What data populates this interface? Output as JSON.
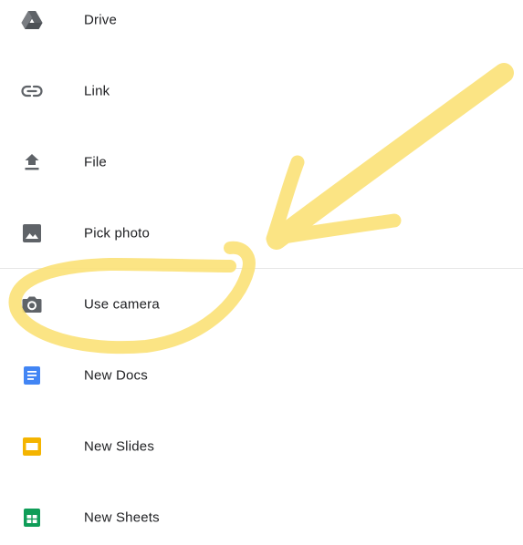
{
  "menu": {
    "items": [
      {
        "label": "Drive",
        "icon": "drive-icon"
      },
      {
        "label": "Link",
        "icon": "link-icon"
      },
      {
        "label": "File",
        "icon": "upload-icon"
      },
      {
        "label": "Pick photo",
        "icon": "image-icon"
      },
      {
        "label": "Use camera",
        "icon": "camera-icon"
      },
      {
        "label": "New Docs",
        "icon": "docs-icon"
      },
      {
        "label": "New Slides",
        "icon": "slides-icon"
      },
      {
        "label": "New Sheets",
        "icon": "sheets-icon"
      }
    ]
  },
  "colors": {
    "icon_gray": "#5f6368",
    "docs_blue": "#4285f4",
    "slides_yellow": "#f4b400",
    "sheets_green": "#0f9d58",
    "highlighter": "#fbe27a"
  }
}
